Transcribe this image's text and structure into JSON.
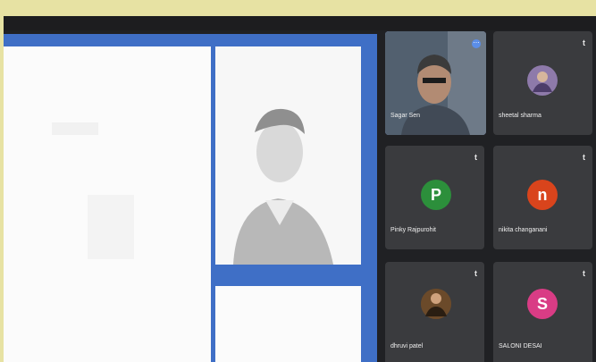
{
  "screen_share": {},
  "participants": [
    {
      "name": "Sagar Sen",
      "initial": "",
      "color": "#2f3a4b",
      "mic": "",
      "type": "video"
    },
    {
      "name": "sheetal sharma",
      "initial": "",
      "color": "#8e7aaa",
      "mic": "t",
      "type": "photo"
    },
    {
      "name": "Pinky Rajpurohit",
      "initial": "P",
      "color": "#2c8f3b",
      "mic": "t",
      "type": "letter"
    },
    {
      "name": "nikita changanani",
      "initial": "n",
      "color": "#d9441c",
      "mic": "t",
      "type": "letter"
    },
    {
      "name": "dhruvi patel",
      "initial": "",
      "color": "#6b4a2a",
      "mic": "t",
      "type": "photo"
    },
    {
      "name": "SALONI DESAI",
      "initial": "S",
      "color": "#d93c85",
      "mic": "t",
      "type": "letter"
    }
  ],
  "icons": {
    "pin": "pin-icon",
    "mic": "mic-off-icon"
  }
}
